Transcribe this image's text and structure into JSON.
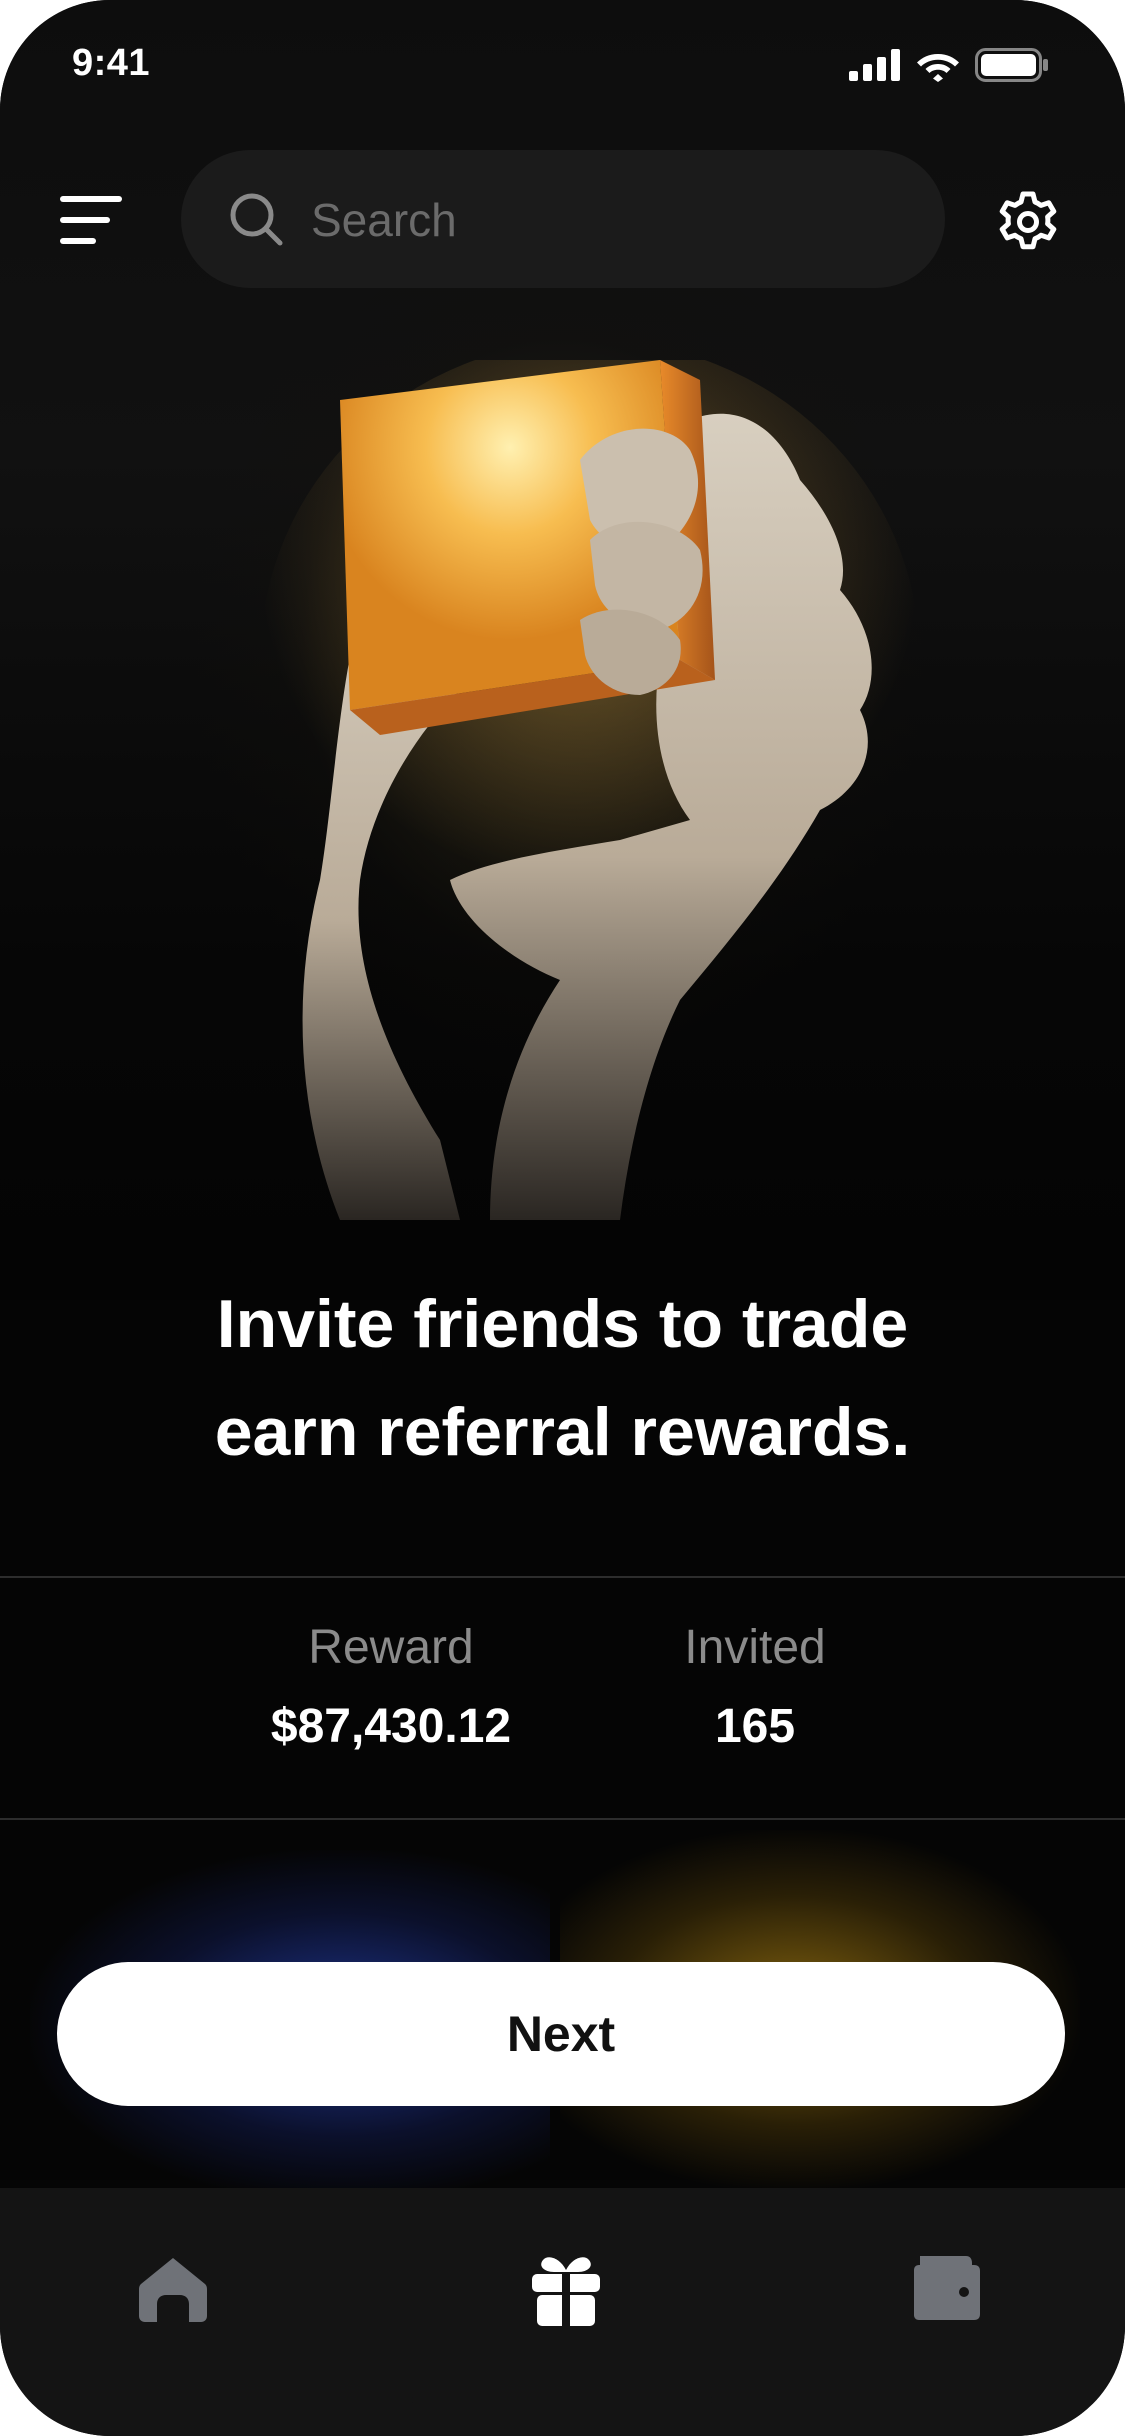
{
  "status_bar": {
    "time": "9:41",
    "signal_icon": "cellular-signal-icon",
    "wifi_icon": "wifi-icon",
    "battery_icon": "battery-icon"
  },
  "header": {
    "menu_icon": "menu-icon",
    "search": {
      "placeholder": "Search",
      "icon": "search-icon"
    },
    "settings_icon": "gear-icon"
  },
  "hero": {
    "image": "glowing-block-in-hand-illustration"
  },
  "headline": {
    "line1": "Invite friends to trade",
    "line2": "earn referral rewards."
  },
  "stats": {
    "reward": {
      "label": "Reward",
      "value": "$87,430.12"
    },
    "invited": {
      "label": "Invited",
      "value": "165"
    }
  },
  "cta": {
    "label": "Next"
  },
  "tab_bar": {
    "items": [
      {
        "icon": "home-icon",
        "active": false
      },
      {
        "icon": "gift-icon",
        "active": true
      },
      {
        "icon": "wallet-icon",
        "active": false
      }
    ]
  },
  "colors": {
    "background": "#050505",
    "search_bg": "#1b1b1b",
    "tab_bar_bg": "#141414",
    "accent_blue": "#2d50dc",
    "accent_gold": "#c89614",
    "inactive_icon": "#6f7278"
  }
}
